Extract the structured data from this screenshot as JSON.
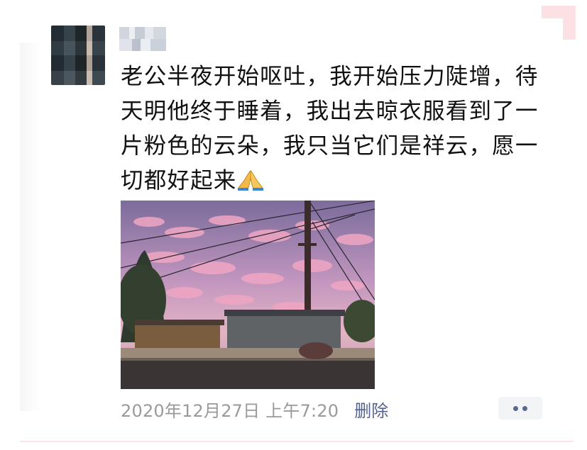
{
  "post": {
    "text": "老公半夜开始呕吐，我开始压力陡增，待天明他终于睡着，我出去晾衣服看到了一片粉色的云朵，我只当它们是祥云，愿一切都好起来",
    "emoji_icon": "pray-icon"
  },
  "meta": {
    "timestamp": "2020年12月27日 上午7:20",
    "delete_label": "删除"
  },
  "colors": {
    "text": "#111111",
    "timestamp": "#9a9a9a",
    "link": "#54638f",
    "sky_pink": "#d9a0bb"
  }
}
